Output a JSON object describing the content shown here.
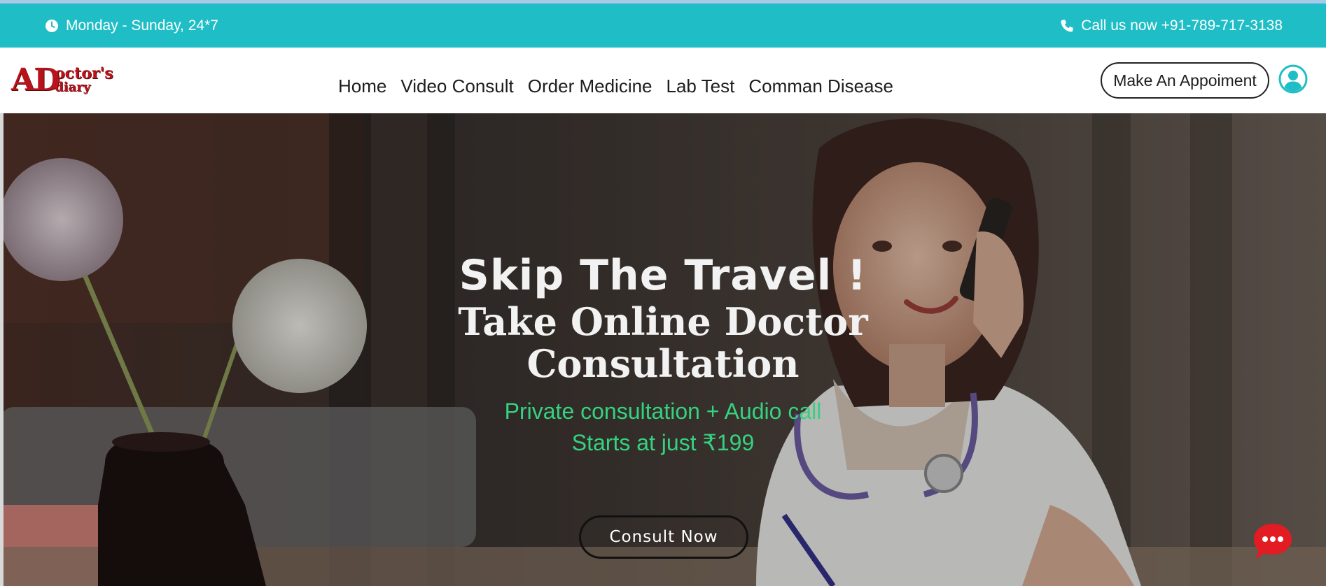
{
  "infobar": {
    "hours_icon": "clock-icon",
    "hours": "Monday - Sunday, 24*7",
    "phone_icon": "phone-icon",
    "phone": "Call us now +91-789-717-3138",
    "color": "#1fbdc5"
  },
  "logo": {
    "big": "AD",
    "top": "octor's",
    "bottom": "diary",
    "color": "#b8131b"
  },
  "nav": {
    "items": [
      "Home",
      "Video Consult",
      "Order Medicine",
      "Lab Test",
      "Comman Disease"
    ]
  },
  "header": {
    "appointment_label": "Make An Appoiment",
    "user_icon": "user-circle-icon",
    "accent": "#1fbdc5"
  },
  "hero": {
    "headline": "Skip The Travel !",
    "subheadline": "Take Online Doctor Consultation",
    "tagline_1": "Private consultation + Audio call",
    "tagline_2": "Starts at just ₹199",
    "tagline_color": "#35d27f",
    "cta_label": "Consult Now"
  },
  "chat": {
    "icon": "chat-bubble-icon",
    "color": "#e31b23"
  }
}
